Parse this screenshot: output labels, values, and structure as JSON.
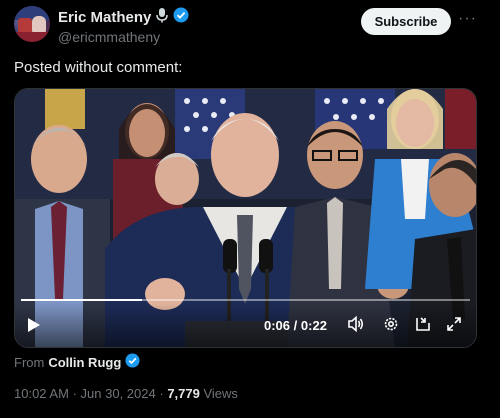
{
  "author": {
    "name": "Eric Matheny",
    "handle": "@ericmmatheny"
  },
  "header": {
    "subscribe_label": "Subscribe",
    "more_label": "···"
  },
  "tweet": {
    "text": "Posted without comment:"
  },
  "video": {
    "current_time": "0:06",
    "time_separator": "/",
    "duration": "0:22",
    "progress_fraction": 0.27
  },
  "source": {
    "from_label": "From",
    "from_name": "Collin Rugg"
  },
  "meta": {
    "time": "10:02 AM",
    "separator": "·",
    "date": "Jun 30, 2024",
    "views_count": "7,779",
    "views_label": "Views"
  },
  "colors": {
    "background": "#000000",
    "text": "#e7e9ea",
    "muted": "#71767b",
    "verified": "#1d9bf0",
    "subscribe_bg": "#eff3f4"
  }
}
